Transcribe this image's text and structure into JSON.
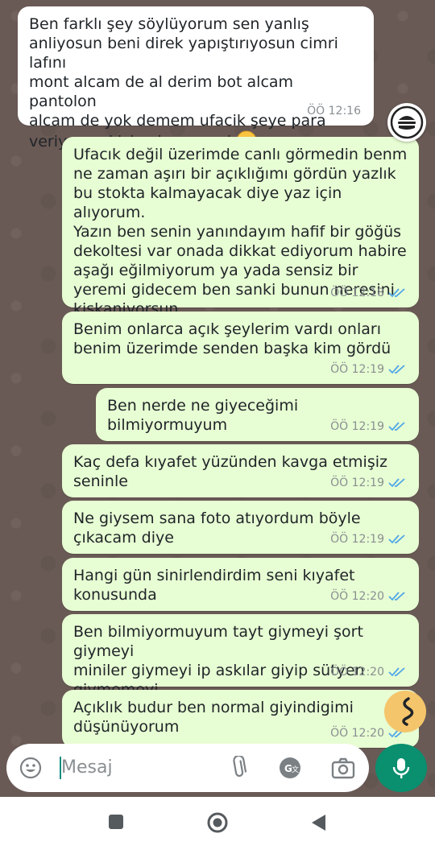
{
  "messages": [
    {
      "direction": "in",
      "text": "Ben farklı şey söylüyorum sen yanlış\nanliyosun beni direk yapıştırıyosun cimri lafını\nmont alcam de al derim bot alcam pantolon\nalcam de yok demem ufacik şeye para\nveriyosun kiskaniyom seni",
      "emoji": "smirking-face",
      "time": "ÖÖ 12:16"
    },
    {
      "direction": "out",
      "text": "Ufacık değil üzerimde canlı görmedin benm\nne zaman aşırı bir açıklığımı gördün yazlık\nbu stokta kalmayacak diye yaz için alıyorum.\nYazın ben senin yanındayım hafif bir göğüs\ndekoltesi var onada dikkat ediyorum habire\naşağı eğilmiyorum ya yada sensiz bir\nyeremi gidecem ben sanki bunun neresini\nkiskaniyorsun",
      "time": "ÖÖ 12:18",
      "read": true
    },
    {
      "direction": "out",
      "text": "Benim onlarca açık şeylerim vardı onları\nbenim üzerimde senden başka kim gördü",
      "time": "ÖÖ 12:19",
      "read": true
    },
    {
      "direction": "out",
      "text": "Ben nerde ne giyeceğimi bilmiyormuyum",
      "time": "ÖÖ 12:19",
      "read": true
    },
    {
      "direction": "out",
      "text": "Kaç defa kıyafet yüzünden kavga etmişiz\nseninle",
      "time": "ÖÖ 12:19",
      "read": true
    },
    {
      "direction": "out",
      "text": "Ne giysem sana foto atıyordum böyle\nçıkacam diye",
      "time": "ÖÖ 12:19",
      "read": true
    },
    {
      "direction": "out",
      "text": "Hangi gün sinirlendirdim seni kıyafet\nkonusunda",
      "time": "ÖÖ 12:20",
      "read": true
    },
    {
      "direction": "out",
      "text": "Ben bilmiyormuyum tayt giymeyi şort giymeyi\nminiler giymeyi ip askılar giyip sütyen\ngiymemeyi",
      "time": "ÖÖ 12:20",
      "read": true
    },
    {
      "direction": "out",
      "text": "Açıklık budur ben normal giyindigimi\ndüşünüyorum",
      "time": "ÖÖ 12:20",
      "read": true
    }
  ],
  "composer": {
    "placeholder": "Mesaj",
    "icons": [
      "emoji-icon",
      "attach-icon",
      "translate-icon",
      "camera-icon",
      "mic-icon"
    ]
  },
  "floating": [
    "burger-menu-icon",
    "squiggle-assist-icon"
  ],
  "nav": [
    "recents-icon",
    "home-icon",
    "back-icon"
  ],
  "colors": {
    "background": "#695a55",
    "incoming": "#ffffff",
    "outgoing": "#e7fdd3",
    "read_ticks": "#4fa6e8",
    "mic": "#0a8f6f",
    "assist": "#f4c56b"
  }
}
